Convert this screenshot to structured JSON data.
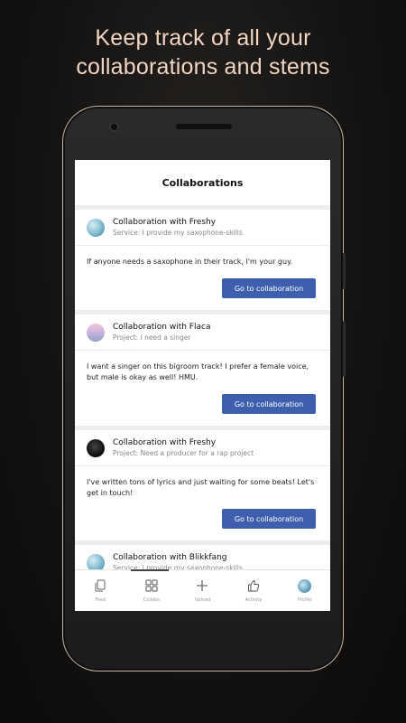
{
  "headline": {
    "line1": "Keep track of all your",
    "line2": "collaborations and stems"
  },
  "appbar": {
    "title": "Collaborations"
  },
  "cards": [
    {
      "title": "Collaboration with Freshy",
      "subtitle": "Service: I provide my saxophone-skills",
      "body": "If anyone needs a saxophone in their track, I'm your guy.",
      "button": "Go to collaboration",
      "avatar": "avatar-freshy"
    },
    {
      "title": "Collaboration with Flaca",
      "subtitle": "Project: I need a singer",
      "body": "I want a singer on this bigroom track! I prefer a female voice, but male is okay as well! HMU.",
      "button": "Go to collaboration",
      "avatar": "avatar-flaca"
    },
    {
      "title": "Collaboration with Freshy",
      "subtitle": "Project: Need a producer for a rap project",
      "body": "I've written tons of lyrics and just waiting for some beats! Let's get in touch!",
      "button": "Go to collaboration",
      "avatar": "avatar-dark"
    },
    {
      "title": "Collaboration with Blikkfang",
      "subtitle": "Service: I provide my saxophone-skills",
      "avatar": "avatar-blikkfang"
    }
  ],
  "nav": [
    {
      "label": "Feed",
      "icon": "feed-icon"
    },
    {
      "label": "Collabs",
      "icon": "grid-icon",
      "active": true
    },
    {
      "label": "Upload",
      "icon": "plus-icon"
    },
    {
      "label": "Activity",
      "icon": "thumbs-up-icon"
    },
    {
      "label": "Profile",
      "icon": "profile-avatar"
    }
  ],
  "colors": {
    "accent": "#3d5fae",
    "headline": "#f1d5c2",
    "background": "#141312"
  }
}
